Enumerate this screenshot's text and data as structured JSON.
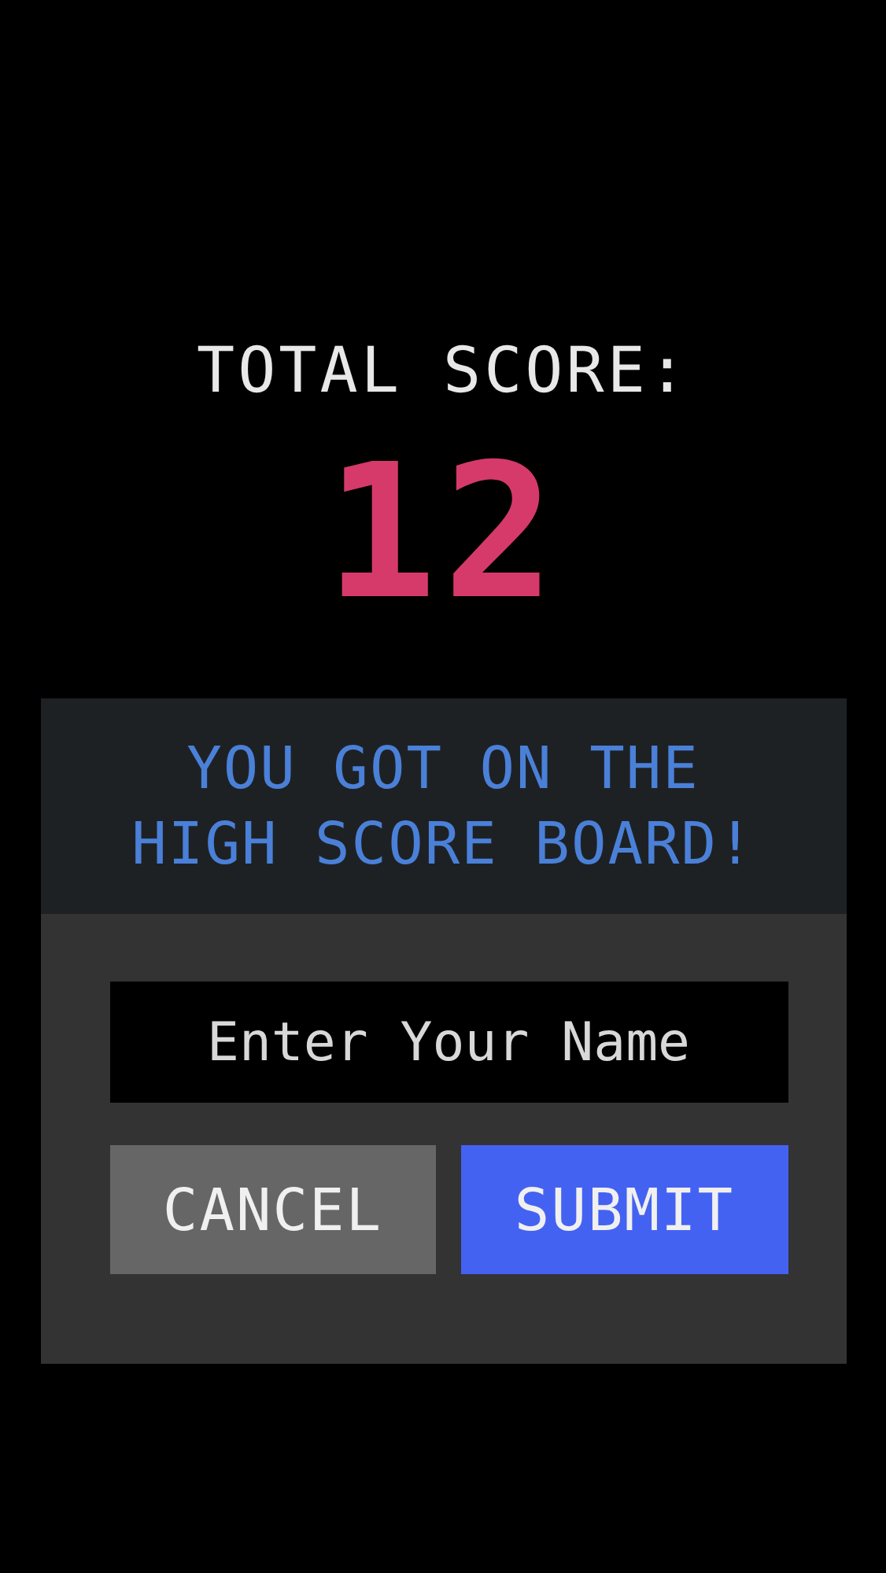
{
  "score_label": "TOTAL SCORE:",
  "score": "12",
  "dialog": {
    "title_lines": [
      "YOU GOT ON THE",
      "HIGH SCORE BOARD!"
    ],
    "name_field": {
      "placeholder": "Enter Your Name"
    },
    "buttons": [
      {
        "label": "CANCEL",
        "kind": "cancel"
      },
      {
        "label": "SUBMIT",
        "kind": "submit"
      }
    ]
  }
}
